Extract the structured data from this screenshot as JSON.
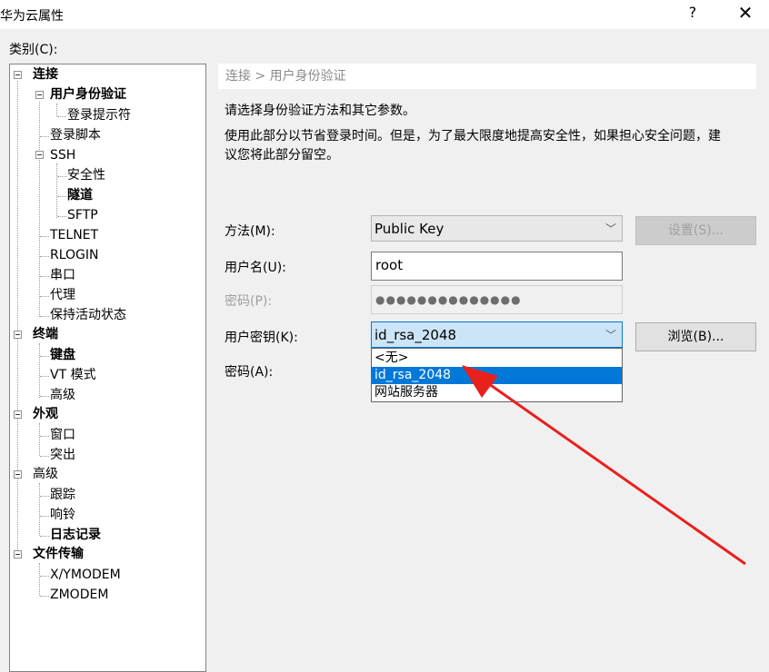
{
  "window": {
    "title": "华为云属性",
    "help": "?",
    "close": "✕"
  },
  "category_label": "类别(C):",
  "tree": {
    "connection": "连接",
    "user_auth": "用户身份验证",
    "login_prompts": "登录提示符",
    "login_script": "登录脚本",
    "ssh": "SSH",
    "security": "安全性",
    "tunnel": "隧道",
    "sftp": "SFTP",
    "telnet": "TELNET",
    "rlogin": "RLOGIN",
    "serial": "串口",
    "proxy": "代理",
    "keepalive": "保持活动状态",
    "terminal": "终端",
    "keyboard": "键盘",
    "vt_mode": "VT 模式",
    "advanced_term": "高级",
    "appearance": "外观",
    "window": "窗口",
    "highlight": "突出",
    "advanced": "高级",
    "trace": "跟踪",
    "bell": "响铃",
    "logging": "日志记录",
    "file_transfer": "文件传输",
    "xymodem": "X/YMODEM",
    "zmodem": "ZMODEM"
  },
  "panel": {
    "breadcrumb": "连接 > 用户身份验证",
    "intro": "请选择身份验证方法和其它参数。",
    "desc_line1": "使用此部分以节省登录时间。但是，为了最大限度地提高安全性，如果担心安全问题，建",
    "desc_line2": "议您将此部分留空。",
    "method_label": "方法(M):",
    "method_value": "Public Key",
    "setup_button": "设置(S)...",
    "username_label": "用户名(U):",
    "username_value": "root",
    "password_label": "密码(P):",
    "password_value": "●●●●●●●●●●●●●●",
    "userkey_label": "用户密钥(K):",
    "userkey_value": "id_rsa_2048",
    "browse_button": "浏览(B)...",
    "passphrase_label": "密码(A):",
    "dropdown_options": [
      "<无>",
      "id_rsa_2048",
      "网站服务器"
    ],
    "dropdown_selected_index": 1
  },
  "colors": {
    "selection": "#0078d7",
    "annotation_arrow": "#e8211d"
  }
}
